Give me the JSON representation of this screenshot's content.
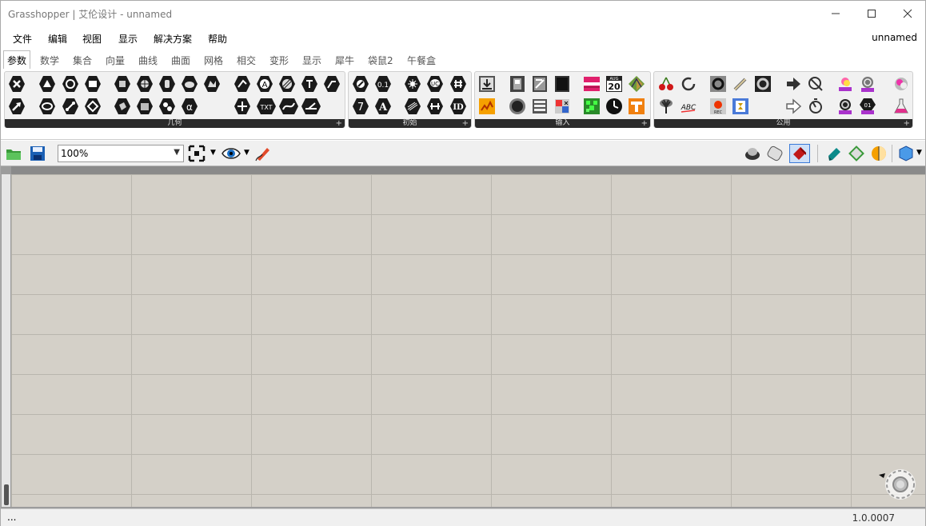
{
  "window": {
    "title": "Grasshopper | 艾伦设计 - unnamed",
    "controls": [
      "minimize",
      "maximize",
      "close"
    ]
  },
  "menubar": {
    "items": [
      "文件",
      "编辑",
      "视图",
      "显示",
      "解决方案",
      "帮助"
    ],
    "doc_name": "unnamed"
  },
  "tabs": {
    "items": [
      "参数",
      "数学",
      "集合",
      "向量",
      "曲线",
      "曲面",
      "网格",
      "相交",
      "变形",
      "显示",
      "犀牛",
      "袋鼠2",
      "午餐盒"
    ],
    "active": "参数"
  },
  "ribbon": {
    "panels": [
      {
        "label": "几何",
        "expand": "+"
      },
      {
        "label": "初始",
        "expand": "+"
      },
      {
        "label": "输入",
        "expand": "+"
      },
      {
        "label": "公用",
        "expand": "+"
      }
    ],
    "calendar_icon": {
      "month": "AUG",
      "day": "20"
    },
    "number_icon": "0.1",
    "text_icon": "A",
    "digit_icon": "7",
    "id_icon": "ID",
    "txt_icon": "TXT",
    "abc_icon": "ABC",
    "rec_icon": "REC"
  },
  "canvas_toolbar": {
    "zoom": "100%"
  },
  "statusbar": {
    "left": "...",
    "version": "1.0.0007"
  },
  "colors": {
    "canvas": "#d4d0c8",
    "grid": "#b9b6ae",
    "panel_footer": "#2b2b2b"
  }
}
